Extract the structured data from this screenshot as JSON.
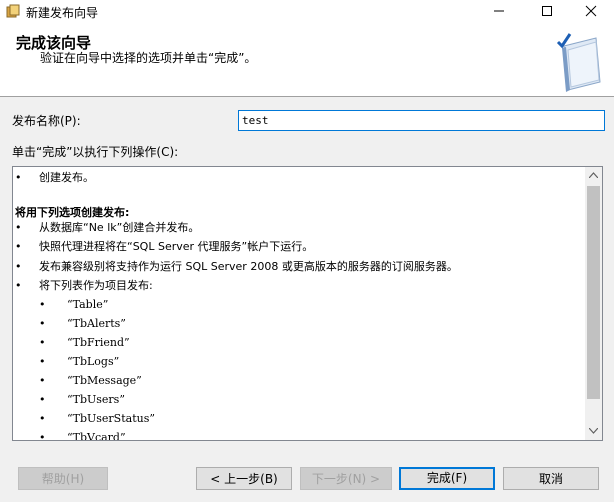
{
  "window": {
    "title": "新建发布向导",
    "icons": {
      "app": "app-icon",
      "minimize": "minimize-icon",
      "maximize": "maximize-icon",
      "close": "close-icon"
    }
  },
  "header": {
    "title": "完成该向导",
    "subtitle": "验证在向导中选择的选项并单击“完成”。",
    "icon": "wizard-book-check-icon"
  },
  "form": {
    "publication_name_label": "发布名称(P):",
    "publication_name_value": "test",
    "actions_label": "单击“完成”以执行下列操作(C):"
  },
  "summary": {
    "bullet": "•",
    "lines": [
      "创建发布。",
      "将用下列选项创建发布:",
      "从数据库“Ne  lk”创建合并发布。",
      "快照代理进程将在“SQL Server 代理服务”帐户下运行。",
      "发布兼容级别将支持作为运行 SQL Server 2008 或更高版本的服务器的订阅服务器。",
      "将下列表作为项目发布:"
    ],
    "tables": [
      "“Table”",
      "“TbAlerts”",
      "“TbFriend”",
      "“TbLogs”",
      "“TbMessage”",
      "“TbUsers”",
      "“TbUserStatus”",
      "“TbVcard”"
    ]
  },
  "buttons": {
    "help": "帮助(H)",
    "back": "< 上一步(B)",
    "next": "下一步(N) >",
    "finish": "完成(F)",
    "cancel": "取消"
  }
}
